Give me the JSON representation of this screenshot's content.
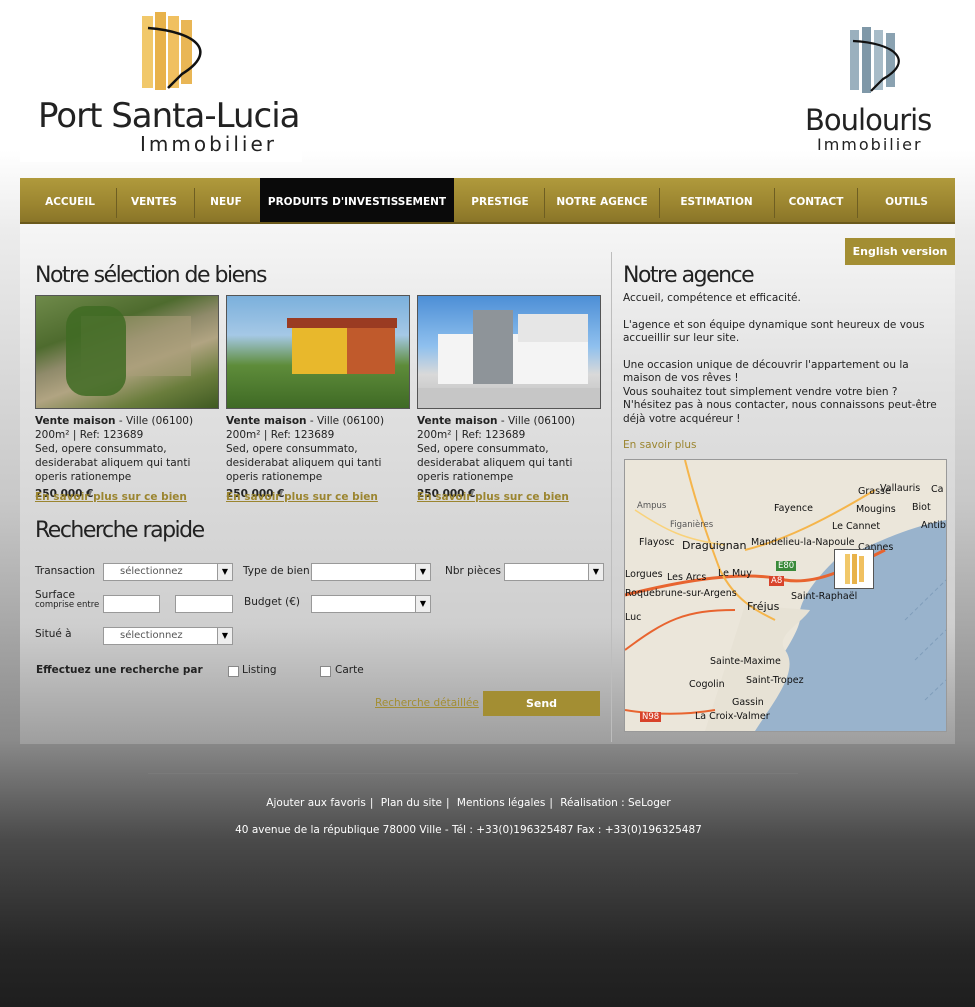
{
  "brand": {
    "name": "Port Santa-Lucia",
    "sub": "Immobilier"
  },
  "partner": {
    "name": "Boulouris",
    "sub": "Immobilier"
  },
  "nav": [
    "ACCUEIL",
    "VENTES",
    "NEUF",
    "PRODUITS D'INVESTISSEMENT",
    "PRESTIGE",
    "NOTRE AGENCE",
    "ESTIMATION",
    "CONTACT",
    "OUTILS"
  ],
  "nav_active": "PRODUITS D'INVESTISSEMENT",
  "english_label": "English version",
  "selection": {
    "title": "Notre sélection de biens",
    "items": [
      {
        "type": "Vente maison",
        "place": " - Ville (06100)",
        "meta": "200m² | Ref: 123689",
        "desc": "Sed, opere consummato, desiderabat aliquem qui tanti operis rationempe",
        "price": "250 000 €",
        "link": "En savoir plus sur ce bien"
      },
      {
        "type": "Vente maison",
        "place": " - Ville (06100)",
        "meta": "200m² | Ref: 123689",
        "desc": "Sed, opere consummato, desiderabat aliquem qui tanti operis rationempe",
        "price": "250 000 €",
        "link": "En savoir plus sur ce bien"
      },
      {
        "type": "Vente maison",
        "place": " - Ville (06100)",
        "meta": "200m² | Ref: 123689",
        "desc": "Sed, opere consummato, desiderabat aliquem qui tanti operis rationempe",
        "price": "250 000 €",
        "link": "En savoir plus sur ce bien"
      }
    ]
  },
  "search": {
    "title": "Recherche rapide",
    "transaction_label": "Transaction",
    "transaction_value": "sélectionnez",
    "type_label": "Type de bien",
    "type_value": "",
    "rooms_label": "Nbr pièces",
    "rooms_value": "",
    "surface_label": "Surface",
    "surface_sub": "comprise entre",
    "budget_label": "Budget (€)",
    "budget_value": "",
    "location_label": "Situé à",
    "location_value": "sélectionnez",
    "search_by_label": "Effectuez une recherche par",
    "listing_label": "Listing",
    "map_label": "Carte",
    "detail_link": "Recherche détaillée",
    "send_label": "Send"
  },
  "agency": {
    "title": "Notre agence",
    "line1": "Accueil, compétence et efficacité.",
    "line2": "L'agence et son équipe dynamique sont heureux de vous accueillir sur leur site.",
    "line3": "Une occasion unique de découvrir l'appartement ou la maison de vos rêves !",
    "line4": "Vous souhaitez tout simplement vendre votre bien ?",
    "line5": "N'hésitez pas à nous contacter, nous connaissons peut-être déjà votre acquéreur !",
    "more": "En savoir plus"
  },
  "map": {
    "labels": [
      "Grasse",
      "Vallauris",
      "Ca",
      "Fayence",
      "Mougins",
      "Biot",
      "Ampus",
      "Figanières",
      "Le Cannet",
      "Antib",
      "Flayosc",
      "Draguignan",
      "Mandelieu-la-Napoule",
      "Cannes",
      "E80",
      "Lorgues",
      "Les Arcs",
      "Le Muy",
      "A8",
      "Roquebrune-sur-Argens",
      "Saint-Raphaël",
      "Fréjus",
      "Luc",
      "Sainte-Maxime",
      "Cogolin",
      "Saint-Tropez",
      "Gassin",
      "N98",
      "La Croix-Valmer"
    ]
  },
  "footer": {
    "favorites": "Ajouter aux favoris",
    "sitemap": "Plan du site",
    "legal": "Mentions légales",
    "credit": "Réalisation : SeLoger",
    "address": "40 avenue de la république  78000 Ville   -  Tél : +33(0)196325487 Fax : +33(0)196325487"
  },
  "colors": {
    "accent": "#a38e33",
    "nav": "#9b8530",
    "active": "#0a0a0a"
  }
}
